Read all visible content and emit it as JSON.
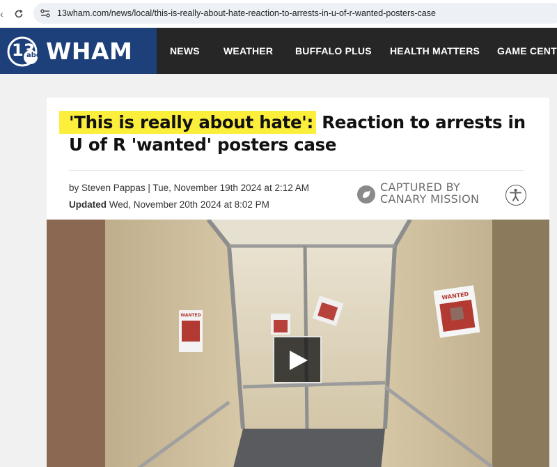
{
  "browser": {
    "url": "13wham.com/news/local/this-is-really-about-hate-reaction-to-arrests-in-u-of-r-wanted-posters-case"
  },
  "site": {
    "logo_text": "WHAM",
    "logo_badge": "13",
    "logo_network": "abc",
    "brand_color": "#1d3f7a",
    "nav": [
      "NEWS",
      "WEATHER",
      "BUFFALO PLUS",
      "HEALTH MATTERS",
      "GAME CENTER"
    ]
  },
  "article": {
    "headline_highlight": "'This is really about hate':",
    "headline_rest": " Reaction to arrests in U of R 'wanted' posters case",
    "highlight_color": "#fbef3b",
    "byline": "by Steven Pappas | Tue, November 19th 2024 at 2:12 AM",
    "updated_label": "Updated",
    "updated_value": " Wed, November 20th 2024 at 8:02 PM",
    "captured_line1": "CAPTURED BY",
    "captured_line2": "CANARY MISSION",
    "poster_text": "WANTED"
  }
}
